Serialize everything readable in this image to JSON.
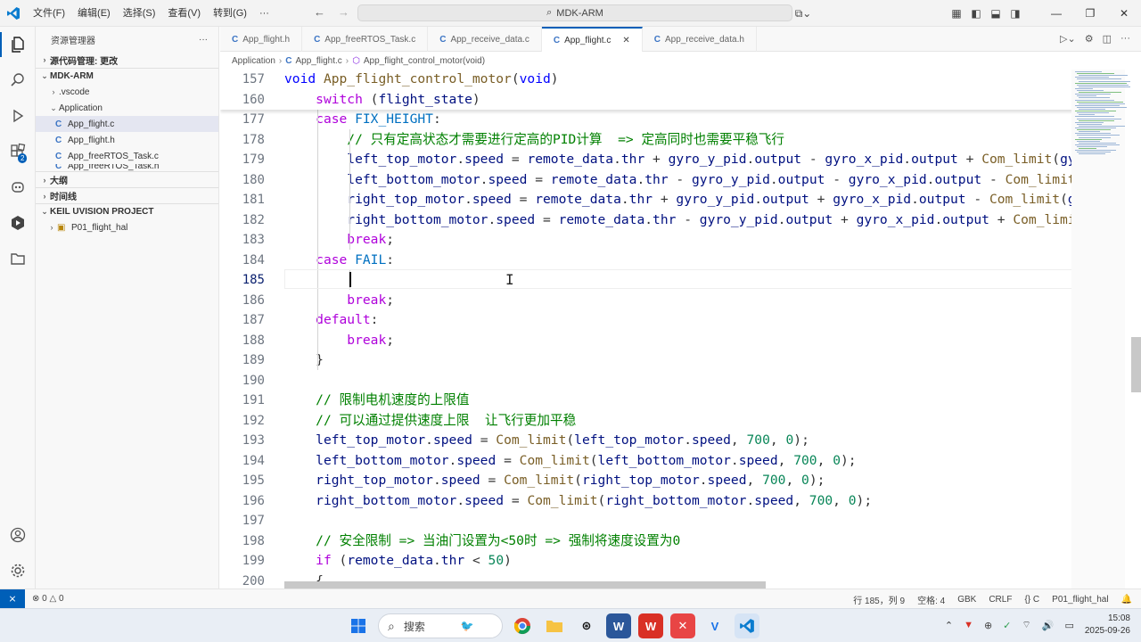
{
  "menu": [
    "文件(F)",
    "编辑(E)",
    "选择(S)",
    "查看(V)",
    "转到(G)",
    "···"
  ],
  "command_center": "MDK-ARM",
  "sidebar": {
    "title": "资源管理器",
    "source_control": "源代码管理: 更改",
    "project": "MDK-ARM",
    "vscode": ".vscode",
    "folder": "Application",
    "files": [
      "App_flight.c",
      "App_flight.h",
      "App_freeRTOS_Task.c",
      "App_freeRTOS_Task.h"
    ],
    "outline": "大纲",
    "timeline": "时间线",
    "keil": "KEIL UVISION PROJECT",
    "keil_item": "P01_flight_hal"
  },
  "activity_badge": "2",
  "tabs": [
    {
      "label": "App_flight.h",
      "active": false
    },
    {
      "label": "App_freeRTOS_Task.c",
      "active": false
    },
    {
      "label": "App_receive_data.c",
      "active": false
    },
    {
      "label": "App_flight.c",
      "active": true
    },
    {
      "label": "App_receive_data.h",
      "active": false
    }
  ],
  "tab_icon_letter": "C",
  "breadcrumb": [
    "Application",
    "App_flight.c",
    "App_flight_control_motor(void)"
  ],
  "sticky_lines": [
    {
      "n": "157",
      "code": "void App_flight_control_motor(void)"
    },
    {
      "n": "160",
      "code": "    switch (flight_state)"
    }
  ],
  "lines": [
    {
      "n": "177",
      "code": "    case FIX_HEIGHT:"
    },
    {
      "n": "178",
      "code": "        // 只有定高状态才需要进行定高的PID计算  => 定高同时也需要平稳飞行"
    },
    {
      "n": "179",
      "code": "        left_top_motor.speed = remote_data.thr + gyro_y_pid.output - gyro_x_pid.output + Com_limit(gyro_z"
    },
    {
      "n": "180",
      "code": "        left_bottom_motor.speed = remote_data.thr - gyro_y_pid.output - gyro_x_pid.output - Com_limit(gyr"
    },
    {
      "n": "181",
      "code": "        right_top_motor.speed = remote_data.thr + gyro_y_pid.output + gyro_x_pid.output - Com_limit(gyro_"
    },
    {
      "n": "182",
      "code": "        right_bottom_motor.speed = remote_data.thr - gyro_y_pid.output + gyro_x_pid.output + Com_limit(gy"
    },
    {
      "n": "183",
      "code": "        break;"
    },
    {
      "n": "184",
      "code": "    case FAIL:"
    },
    {
      "n": "185",
      "code": "        "
    },
    {
      "n": "186",
      "code": "        break;"
    },
    {
      "n": "187",
      "code": "    default:"
    },
    {
      "n": "188",
      "code": "        break;"
    },
    {
      "n": "189",
      "code": "    }"
    },
    {
      "n": "190",
      "code": ""
    },
    {
      "n": "191",
      "code": "    // 限制电机速度的上限值"
    },
    {
      "n": "192",
      "code": "    // 可以通过提供速度上限  让飞行更加平稳"
    },
    {
      "n": "193",
      "code": "    left_top_motor.speed = Com_limit(left_top_motor.speed, 700, 0);"
    },
    {
      "n": "194",
      "code": "    left_bottom_motor.speed = Com_limit(left_bottom_motor.speed, 700, 0);"
    },
    {
      "n": "195",
      "code": "    right_top_motor.speed = Com_limit(right_top_motor.speed, 700, 0);"
    },
    {
      "n": "196",
      "code": "    right_bottom_motor.speed = Com_limit(right_bottom_motor.speed, 700, 0);"
    },
    {
      "n": "197",
      "code": ""
    },
    {
      "n": "198",
      "code": "    // 安全限制 => 当油门设置为<50时 => 强制将速度设置为0"
    },
    {
      "n": "199",
      "code": "    if (remote_data.thr < 50)"
    },
    {
      "n": "200",
      "code": "    {"
    }
  ],
  "current_line": "185",
  "status": {
    "errors": "0",
    "warnings": "0",
    "position": "行 185，列 9",
    "spaces": "空格: 4",
    "encoding": "GBK",
    "eol": "CRLF",
    "language": "C",
    "project": "P01_flight_hal"
  },
  "taskbar": {
    "search": "搜索",
    "time": "15:08",
    "date": "2025-09-26"
  }
}
